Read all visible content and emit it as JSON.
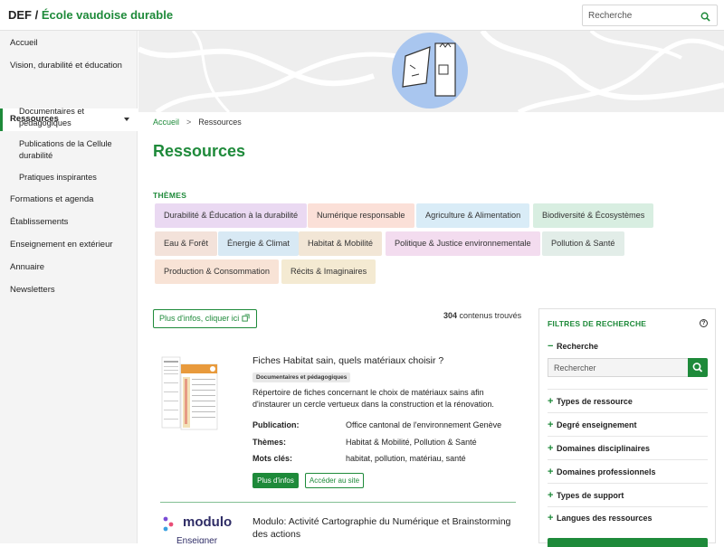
{
  "header": {
    "brand_prefix": "DEF /",
    "brand_name": "École vaudoise durable",
    "search_placeholder": "Recherche"
  },
  "sidebar": {
    "items": [
      {
        "label": "Accueil"
      },
      {
        "label": "Vision, durabilité et éducation"
      },
      {
        "label": "Ressources"
      },
      {
        "label": "Formations et agenda"
      },
      {
        "label": "Établissements"
      },
      {
        "label": "Enseignement en extérieur"
      },
      {
        "label": "Annuaire"
      },
      {
        "label": "Newsletters"
      }
    ],
    "subitems": [
      {
        "label": "Documentaires et pédagogiques"
      },
      {
        "label": "Publications de la Cellule durabilité"
      },
      {
        "label": "Pratiques inspirantes"
      }
    ]
  },
  "breadcrumb": {
    "home": "Accueil",
    "separator": ">",
    "current": "Ressources"
  },
  "page": {
    "title": "Ressources"
  },
  "themes": {
    "label": "THÈMES",
    "chips": [
      {
        "label": "Durabilité & Éducation à la durabilité",
        "color": "#ead9f2"
      },
      {
        "label": "Numérique responsable",
        "color": "#fbe0d8"
      },
      {
        "label": "Agriculture & Alimentation",
        "color": "#d9ecf7"
      },
      {
        "label": "Biodiversité & Écosystèmes",
        "color": "#d8eee1"
      },
      {
        "label": "Eau & Forêt",
        "color": "#f3e2da"
      },
      {
        "label": "Énergie & Climat",
        "color": "#d8e9f4"
      },
      {
        "label": "Habitat & Mobilité",
        "color": "#f2e6d6"
      },
      {
        "label": "Politique & Justice environnementale",
        "color": "#f3dcef"
      },
      {
        "label": "Pollution & Santé",
        "color": "#e2ede8"
      },
      {
        "label": "Production & Consommation",
        "color": "#f8e3d6"
      },
      {
        "label": "Récits & Imaginaires",
        "color": "#f4ead2"
      }
    ]
  },
  "results": {
    "info_button": "Plus d'infos, cliquer ici",
    "count": "304",
    "count_suffix": "contenus trouvés",
    "items": [
      {
        "title": "Fiches Habitat sain, quels matériaux choisir ?",
        "tag": "Documentaires et pédagogiques",
        "description": "Répertoire de fiches concernant le choix de matériaux sains afin d'instaurer un cercle vertueux dans la construction et la rénovation.",
        "publication_label": "Publication:",
        "publication": "Office cantonal de l'environnement Genève",
        "themes_label": "Thèmes:",
        "themes": "Habitat & Mobilité, Pollution & Santé",
        "keywords_label": "Mots clés:",
        "keywords": "habitat, pollution, matériau, santé",
        "more_button": "Plus d'infos",
        "access_button": "Accéder au site"
      },
      {
        "title": "Modulo: Activité Cartographie du Numérique et Brainstorming des actions",
        "logo_text": "modulo",
        "logo_sub": "Enseigner"
      }
    ]
  },
  "filters": {
    "title": "FILTRES DE RECHERCHE",
    "search_section": "Recherche",
    "search_placeholder": "Rechercher",
    "sections": [
      {
        "label": "Types de ressource"
      },
      {
        "label": "Degré enseignement"
      },
      {
        "label": "Domaines disciplinaires"
      },
      {
        "label": "Domaines professionnels"
      },
      {
        "label": "Types de support"
      },
      {
        "label": "Langues des ressources"
      }
    ]
  },
  "colors": {
    "accent": "#1e8a3a"
  }
}
